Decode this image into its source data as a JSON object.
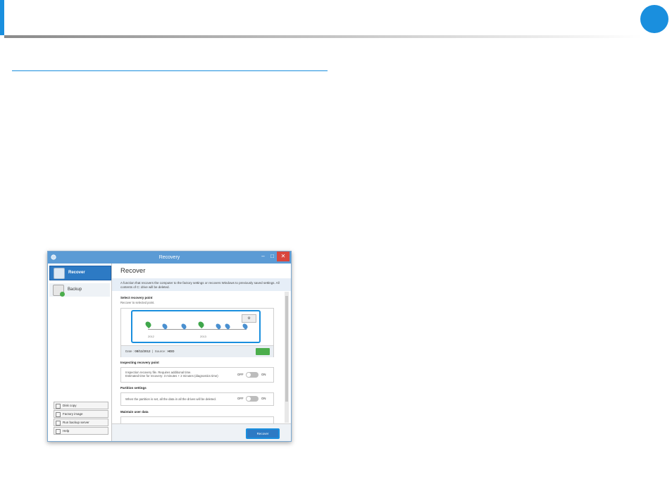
{
  "colors": {
    "accent": "#1a8fde",
    "titlebar": "#5b9bd5",
    "selected": "#2d7ac4",
    "green": "#4cae4c"
  },
  "window": {
    "title": "Recovery",
    "controls": {
      "minimize": "–",
      "maximize": "□",
      "close": "✕"
    }
  },
  "sidebar": {
    "items": [
      {
        "label": "Recover",
        "icon": "recover-icon",
        "selected": true
      },
      {
        "label": "Backup",
        "icon": "backup-icon",
        "selected": false
      }
    ],
    "buttons": [
      {
        "label": "Disk copy",
        "icon": "disk-copy-icon"
      },
      {
        "label": "Factory image",
        "icon": "factory-image-icon"
      },
      {
        "label": "Run backup server",
        "icon": "backup-server-icon"
      },
      {
        "label": "Help",
        "icon": "help-icon"
      }
    ]
  },
  "main": {
    "title": "Recover",
    "description": "A function that recovers the computer to the factory settings or recovers Windows to previously saved settings. All contents of C: drive will be deleted.",
    "recovery_point": {
      "heading": "Select recovery point",
      "subtitle": "Recover to selected point.",
      "years": [
        "2012",
        "2013"
      ],
      "date_label": "Date :",
      "date_value": "08/11/2012",
      "source_label": "Source :",
      "source_value": "HDD"
    },
    "inspecting": {
      "heading": "Inspecting recovery point",
      "text1": "Inspection recovery file. Requires additional time.",
      "text2": "Estimated time for recovery: 3 minutes + 2 minutes (diagnostics time)",
      "off": "OFF",
      "on": "ON"
    },
    "partition": {
      "heading": "Partition settings",
      "text": "When the partition is set, all the data in all the drives will be deleted.",
      "off": "OFF",
      "on": "ON"
    },
    "maintain": {
      "heading": "Maintain user data"
    },
    "recover_button": "Recover"
  }
}
